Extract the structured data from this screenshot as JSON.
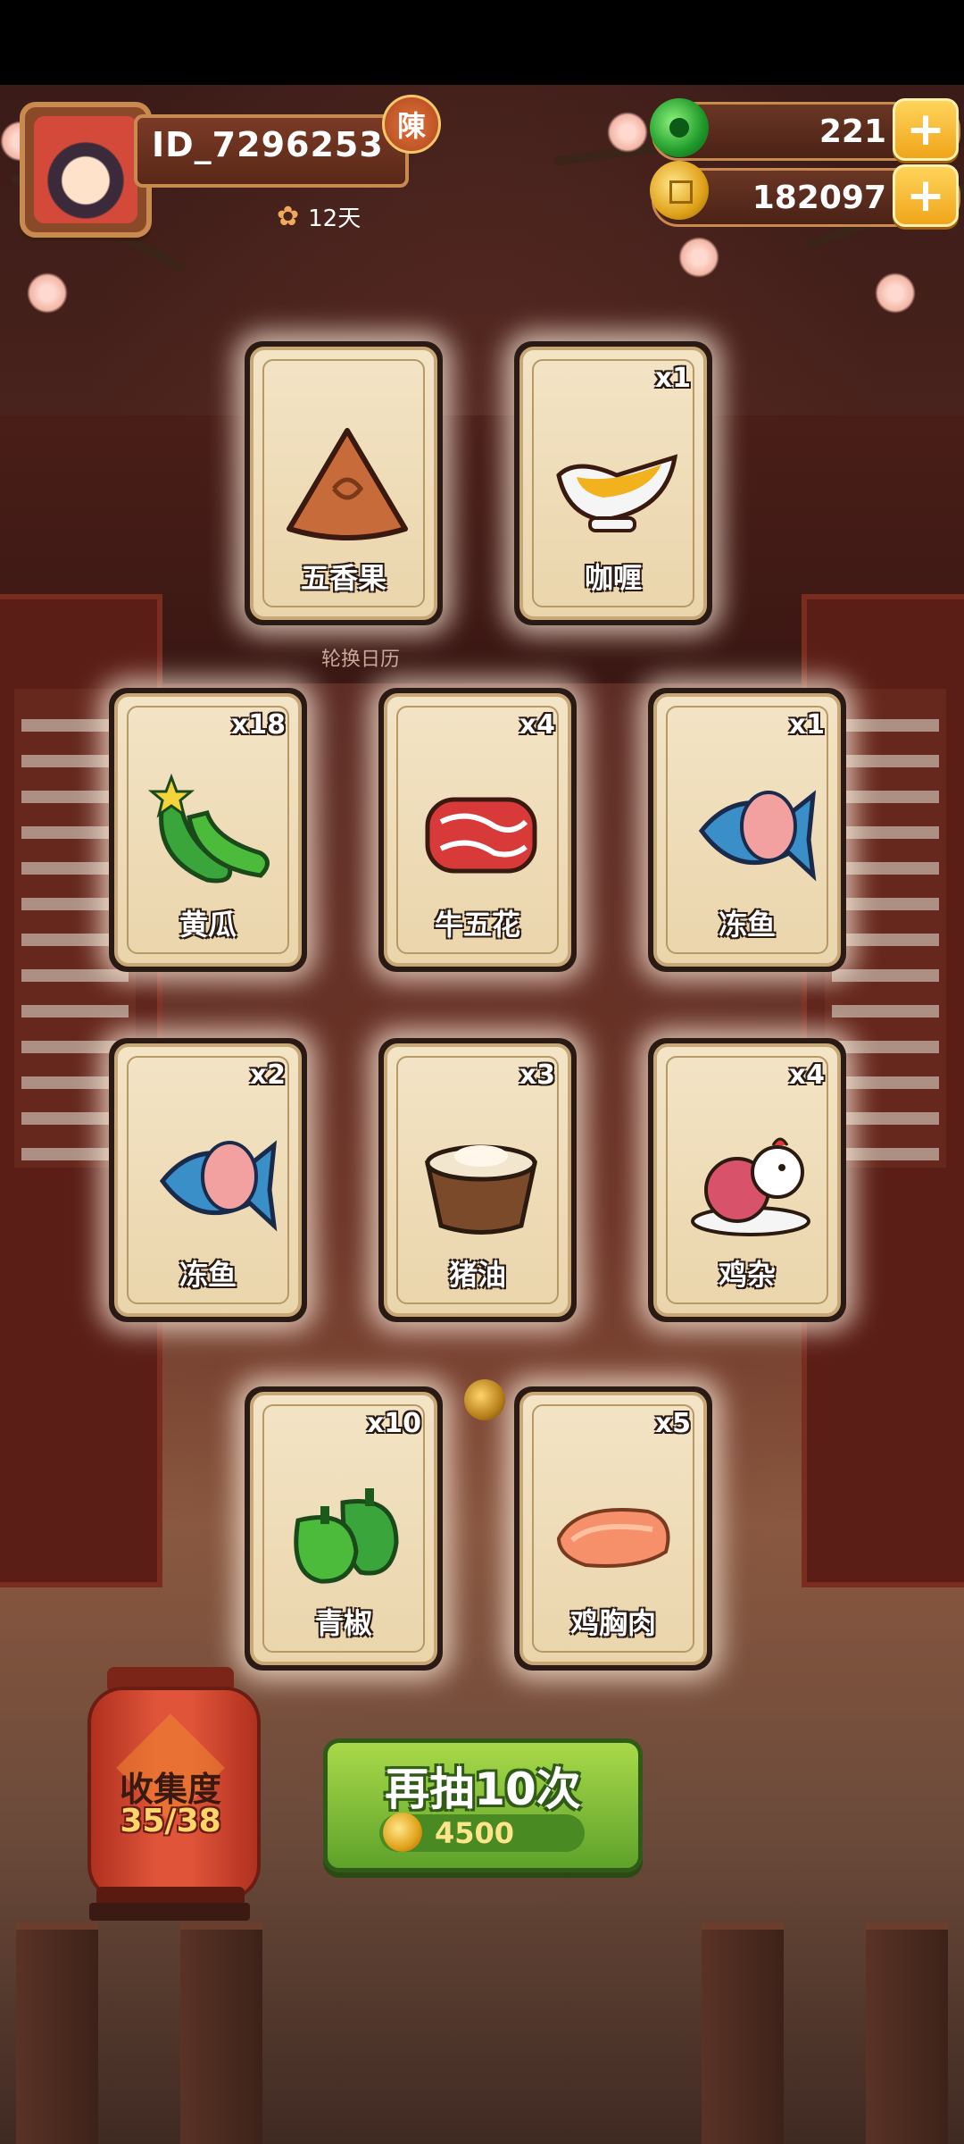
{
  "player": {
    "id": "ID_7296253",
    "badge": "陳",
    "days": "12天"
  },
  "resources": {
    "jade": {
      "value": "221",
      "icon": "jade-icon"
    },
    "coins": {
      "value": "182097",
      "icon": "coin-icon"
    }
  },
  "background": {
    "calendar_label": "轮换日历"
  },
  "cards": [
    {
      "name": "五香果",
      "qty": "",
      "icon": "spice-fruit-icon"
    },
    {
      "name": "咖喱",
      "qty": "x1",
      "icon": "curry-gravy-boat-icon"
    },
    {
      "name": "黄瓜",
      "qty": "x18",
      "icon": "cucumber-icon"
    },
    {
      "name": "牛五花",
      "qty": "x4",
      "icon": "beef-brisket-icon"
    },
    {
      "name": "冻鱼",
      "qty": "x1",
      "icon": "frozen-fish-icon"
    },
    {
      "name": "冻鱼",
      "qty": "x2",
      "icon": "frozen-fish-icon"
    },
    {
      "name": "猪油",
      "qty": "x3",
      "icon": "lard-cup-icon"
    },
    {
      "name": "鸡杂",
      "qty": "x4",
      "icon": "chicken-giblets-icon"
    },
    {
      "name": "青椒",
      "qty": "x10",
      "icon": "green-pepper-icon"
    },
    {
      "name": "鸡胸肉",
      "qty": "x5",
      "icon": "chicken-breast-icon"
    }
  ],
  "collection": {
    "title": "收集度",
    "value": "35/38"
  },
  "draw_button": {
    "label": "再抽10次",
    "cost": "4500"
  },
  "colors": {
    "accent_green": "#5ea22a",
    "gold": "#f0a51b",
    "card_bg": "#f3e4c6"
  }
}
